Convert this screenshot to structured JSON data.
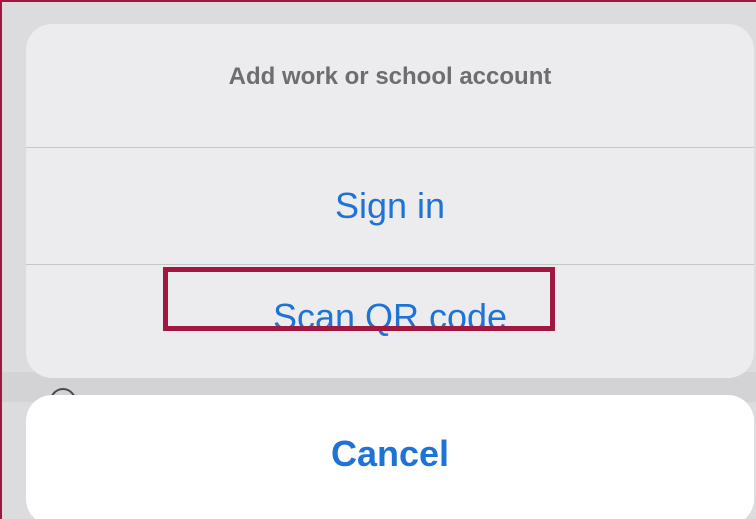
{
  "action_sheet": {
    "title": "Add work or school account",
    "actions": [
      {
        "label": "Sign in"
      },
      {
        "label": "Scan QR code",
        "highlighted": true
      }
    ],
    "cancel_label": "Cancel"
  },
  "colors": {
    "action_text": "#1e73d6",
    "title_text": "#6d6d72",
    "sheet_background": "#ececee",
    "highlight_border": "#a0173f",
    "cancel_background": "#ffffff"
  }
}
